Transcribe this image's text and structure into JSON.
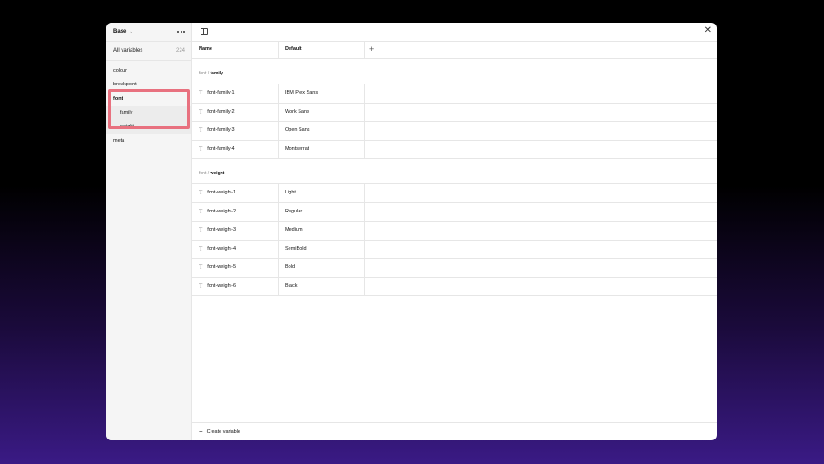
{
  "sidebar": {
    "collection": "Base",
    "all_variables_label": "All variables",
    "all_variables_count": "224",
    "groups": [
      {
        "label": "colour"
      },
      {
        "label": "breakpoint"
      },
      {
        "label": "font"
      },
      {
        "label": "family"
      },
      {
        "label": "weight"
      },
      {
        "label": "meta"
      }
    ]
  },
  "table": {
    "col_name": "Name",
    "col_default": "Default",
    "add_symbol": "+"
  },
  "groups": [
    {
      "prefix": "font / ",
      "name": "family",
      "rows": [
        {
          "name": "font-family-1",
          "value": "IBM Plex Sans"
        },
        {
          "name": "font-family-2",
          "value": "Work Sans"
        },
        {
          "name": "font-family-3",
          "value": "Open Sans"
        },
        {
          "name": "font-family-4",
          "value": "Montserrat"
        }
      ]
    },
    {
      "prefix": "font / ",
      "name": "weight",
      "rows": [
        {
          "name": "font-weight-1",
          "value": "Light"
        },
        {
          "name": "font-weight-2",
          "value": "Regular"
        },
        {
          "name": "font-weight-3",
          "value": "Medium"
        },
        {
          "name": "font-weight-4",
          "value": "SemiBold"
        },
        {
          "name": "font-weight-5",
          "value": "Bold"
        },
        {
          "name": "font-weight-6",
          "value": "Black"
        }
      ]
    }
  ],
  "footer": {
    "create_label": "Create variable"
  },
  "icons": {
    "type": "text-type-icon",
    "close": "close-icon",
    "panel": "sidebar-toggle-icon"
  },
  "colors": {
    "highlight": "#e8717f"
  }
}
